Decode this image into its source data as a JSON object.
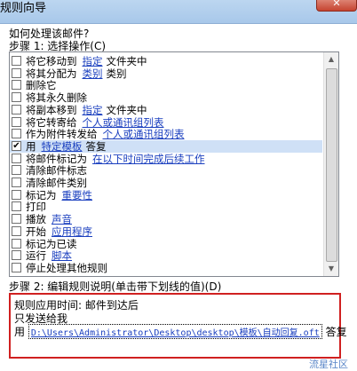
{
  "window": {
    "title": "规则向导",
    "close_label": "✕"
  },
  "question": "如何处理该邮件?",
  "step1_label": "步骤 1: 选择操作(C)",
  "rules": [
    {
      "checked": false,
      "text": "将它移动到",
      "link": "指定",
      "after": "文件夹中"
    },
    {
      "checked": false,
      "text": "将其分配为",
      "link": "类别",
      "after": "类别"
    },
    {
      "checked": false,
      "text": "删除它",
      "link": "",
      "after": ""
    },
    {
      "checked": false,
      "text": "将其永久删除",
      "link": "",
      "after": ""
    },
    {
      "checked": false,
      "text": "将副本移到",
      "link": "指定",
      "after": "文件夹中"
    },
    {
      "checked": false,
      "text": "将它转寄给",
      "link": "个人或通讯组列表",
      "after": ""
    },
    {
      "checked": false,
      "text": "作为附件转发给",
      "link": "个人或通讯组列表",
      "after": ""
    },
    {
      "checked": true,
      "text": "用",
      "link": "特定模板",
      "after": "答复"
    },
    {
      "checked": false,
      "text": "将邮件标记为",
      "link": "在以下时间完成后续工作",
      "after": ""
    },
    {
      "checked": false,
      "text": "清除邮件标志",
      "link": "",
      "after": ""
    },
    {
      "checked": false,
      "text": "清除邮件类别",
      "link": "",
      "after": ""
    },
    {
      "checked": false,
      "text": "标记为",
      "link": "重要性",
      "after": ""
    },
    {
      "checked": false,
      "text": "打印",
      "link": "",
      "after": ""
    },
    {
      "checked": false,
      "text": "播放",
      "link": "声音",
      "after": ""
    },
    {
      "checked": false,
      "text": "开始",
      "link": "应用程序",
      "after": ""
    },
    {
      "checked": false,
      "text": "标记为已读",
      "link": "",
      "after": ""
    },
    {
      "checked": false,
      "text": "运行",
      "link": "脚本",
      "after": ""
    },
    {
      "checked": false,
      "text": "停止处理其他规则",
      "link": "",
      "after": ""
    }
  ],
  "check_glyph": "✔",
  "step2_label": "步骤 2: 编辑规则说明(单击带下划线的值)(D)",
  "description": {
    "line1": "规则应用时间: 邮件到达后",
    "line2": "只发送给我",
    "line3_prefix": "用",
    "line3_path": "D:\\Users\\Administrator\\Desktop\\desktop\\模板\\自动回复.oft",
    "line3_suffix": "答复"
  },
  "watermark": "流星社区",
  "colors": {
    "link": "#1a3fbf",
    "highlight_border": "#d02020",
    "selected_row": "#cfe0f6"
  }
}
